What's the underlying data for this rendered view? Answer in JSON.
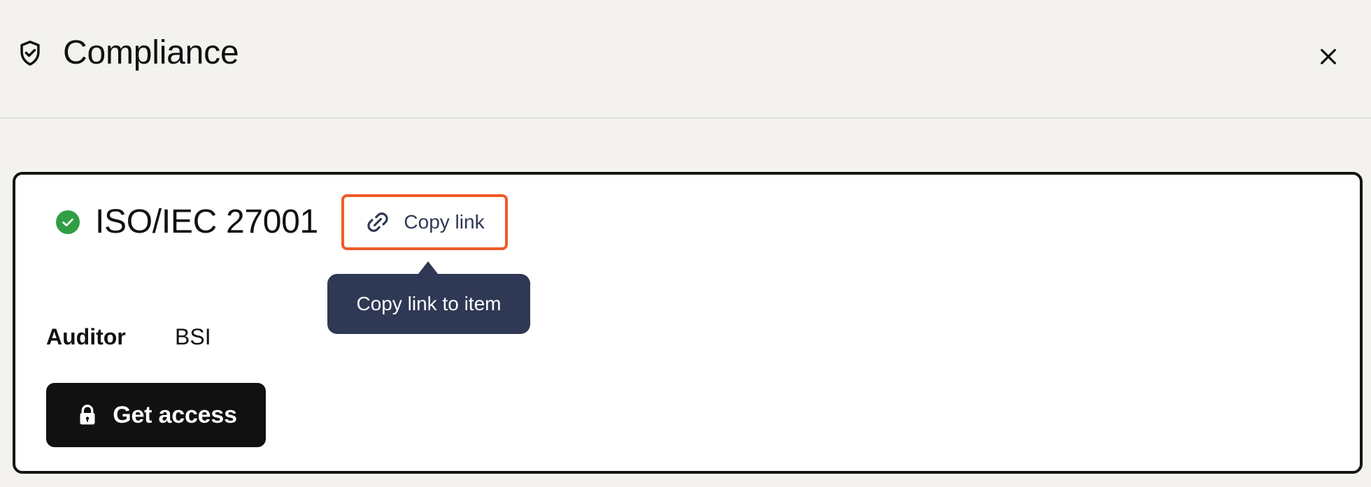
{
  "header": {
    "title": "Compliance",
    "icon": "shield-check-icon",
    "close_icon": "close-icon"
  },
  "item": {
    "status_icon": "check-circle-icon",
    "status_color": "#2f9e44",
    "title": "ISO/IEC 27001",
    "copy_link": {
      "label": "Copy link",
      "icon": "link-icon",
      "highlight_color": "#f05a28"
    },
    "tooltip": {
      "text": "Copy link to item"
    },
    "auditor": {
      "label": "Auditor",
      "value": "BSI"
    },
    "get_access": {
      "label": "Get access",
      "icon": "lock-icon"
    }
  },
  "colors": {
    "page_background": "#f3f2ee",
    "card_border": "#141414",
    "tooltip_background": "#2f3854",
    "button_background": "#111111"
  }
}
